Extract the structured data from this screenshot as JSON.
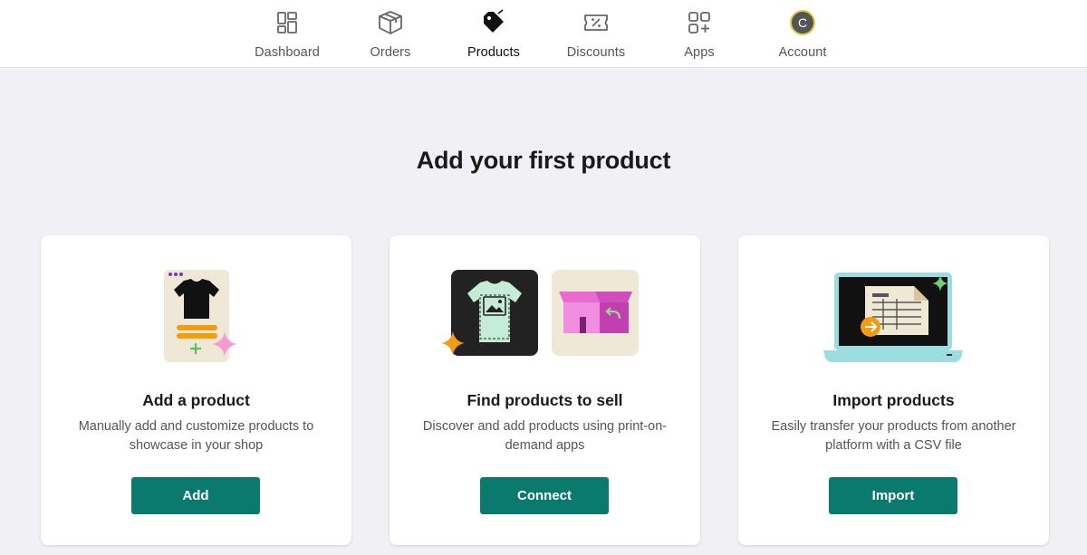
{
  "nav": {
    "items": [
      {
        "label": "Dashboard"
      },
      {
        "label": "Orders"
      },
      {
        "label": "Products"
      },
      {
        "label": "Discounts"
      },
      {
        "label": "Apps"
      },
      {
        "label": "Account"
      }
    ],
    "avatar_initial": "C"
  },
  "main": {
    "title": "Add your first product",
    "cards": [
      {
        "title": "Add a product",
        "description": "Manually add and customize products to showcase in your shop",
        "button": "Add"
      },
      {
        "title": "Find products to sell",
        "description": "Discover and add products using print-on-demand apps",
        "button": "Connect"
      },
      {
        "title": "Import products",
        "description": "Easily transfer your products from another platform with a CSV file",
        "button": "Import"
      }
    ]
  },
  "icons": [
    "dashboard-icon",
    "orders-box-icon",
    "products-tag-icon",
    "discounts-ticket-icon",
    "apps-grid-icon"
  ],
  "colors": {
    "accent_button": "#0b7a6e",
    "page_background": "#f1f1f5",
    "nav_background": "#ffffff",
    "avatar_ring": "#e4c84c"
  }
}
